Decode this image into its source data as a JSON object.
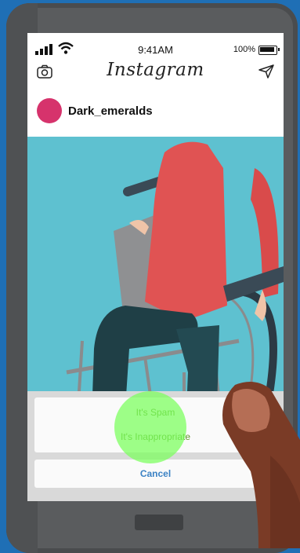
{
  "status_bar": {
    "time": "9:41AM",
    "battery": "100%"
  },
  "header": {
    "app_name": "Instagram"
  },
  "post": {
    "username": "Dark_emeralds",
    "avatar_color": "#d6336c"
  },
  "action_sheet": {
    "options": [
      "It's Spam",
      "It's Inappropriate"
    ],
    "cancel_label": "Cancel"
  },
  "colors": {
    "option_text": "#5f9a2a",
    "cancel_text": "#3b82c4",
    "highlight": "#78ff5a",
    "image_bg": "#5ec1d0"
  },
  "icons": [
    "camera-icon",
    "send-icon",
    "signal-icon",
    "wifi-icon",
    "battery-icon"
  ]
}
